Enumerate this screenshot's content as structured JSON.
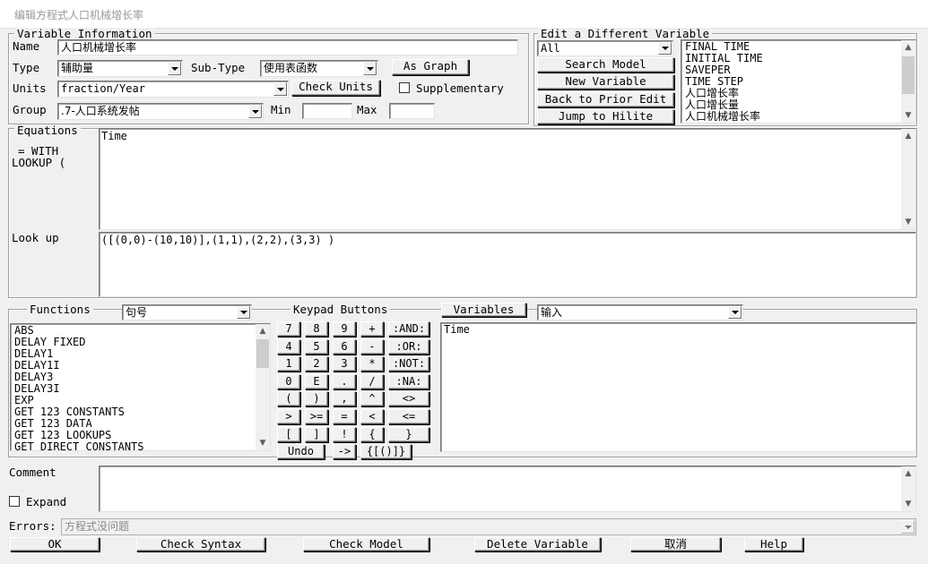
{
  "window": {
    "title": "编辑方程式人口机械增长率"
  },
  "variable_info": {
    "legend": "Variable Information",
    "name_label": "Name",
    "name_value": "人口机械增长率",
    "type_label": "Type",
    "type_value": "辅助量",
    "subtype_label": "Sub-Type",
    "subtype_value": "使用表函数",
    "as_graph_label": "As Graph",
    "units_label": "Units",
    "units_value": "fraction/Year",
    "check_units_label": "Check Units",
    "supplementary_label": "Supplementary",
    "supplementary_checked": false,
    "group_label": "Group",
    "group_value": ".7-人口系统发帖",
    "min_label": "Min",
    "min_value": "",
    "max_label": "Max",
    "max_value": ""
  },
  "edit_different": {
    "legend": "Edit a Different Variable",
    "filter_value": "All",
    "buttons": [
      "Search Model",
      "New Variable",
      "Back to Prior Edit",
      "Jump to Hilite"
    ],
    "variables": [
      "FINAL TIME",
      "INITIAL TIME",
      "SAVEPER",
      "TIME STEP",
      "人口增长率",
      "人口增长量",
      "人口机械增长率"
    ]
  },
  "equations": {
    "label": "Equations",
    "prefix_line1": "= WITH",
    "prefix_line2": "LOOKUP (",
    "value": "Time",
    "lookup_label": "Look up",
    "lookup_value": "([(0,0)-(10,10)],(1,1),(2,2),(3,3) )"
  },
  "functions": {
    "label": "Functions",
    "filter_value": "句号",
    "items": [
      "ABS",
      "DELAY FIXED",
      "DELAY1",
      "DELAY1I",
      "DELAY3",
      "DELAY3I",
      "EXP",
      "GET 123 CONSTANTS",
      "GET 123 DATA",
      "GET 123 LOOKUPS",
      "GET DIRECT CONSTANTS"
    ]
  },
  "keypad": {
    "label": "Keypad Buttons",
    "rows": [
      [
        "7",
        "8",
        "9",
        "+",
        ":AND:"
      ],
      [
        "4",
        "5",
        "6",
        "-",
        ":OR:"
      ],
      [
        "1",
        "2",
        "3",
        "*",
        ":NOT:"
      ],
      [
        "0",
        "E",
        ".",
        "/",
        ":NA:"
      ],
      [
        "(",
        ")",
        ",",
        "^",
        "<>"
      ],
      [
        ">",
        ">=",
        "=",
        "<",
        "<="
      ],
      [
        "[",
        "]",
        "!",
        "{",
        "}"
      ]
    ],
    "undo_label": "Undo",
    "arrow_label": "->",
    "brackets_label": "{[()]}"
  },
  "variables_panel": {
    "button_label": "Variables",
    "filter_value": "输入",
    "items": [
      "Time"
    ]
  },
  "comment": {
    "label": "Comment",
    "expand_label": "Expand",
    "expand_checked": false,
    "value": ""
  },
  "errors": {
    "label": "Errors:",
    "value": "方程式没问题"
  },
  "footer": {
    "ok_label": "OK",
    "check_syntax_label": "Check Syntax",
    "check_model_label": "Check Model",
    "delete_variable_label": "Delete Variable",
    "cancel_label": "取消",
    "help_label": "Help"
  }
}
